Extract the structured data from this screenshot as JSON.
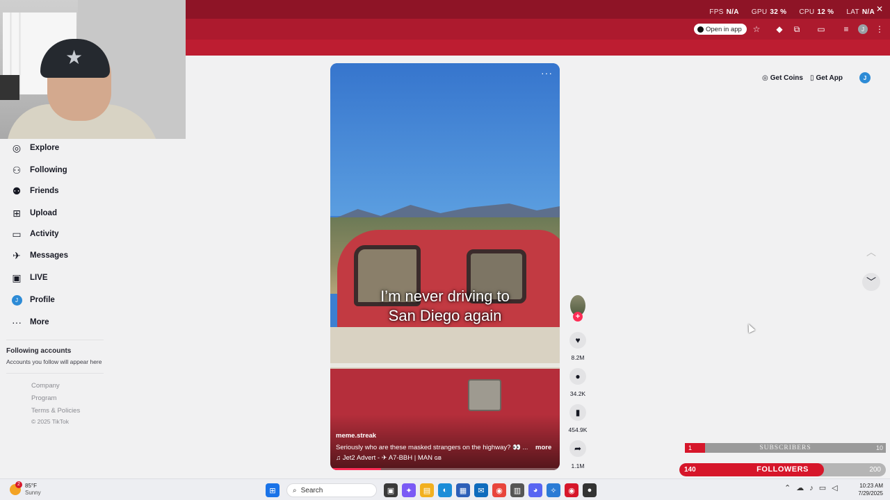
{
  "overlay": {
    "stats": [
      {
        "label": "FPS",
        "value": "N/A"
      },
      {
        "label": "GPU",
        "value": "32 %"
      },
      {
        "label": "CPU",
        "value": "12 %"
      },
      {
        "label": "LAT",
        "value": "N/A"
      }
    ],
    "close_glyph": "✕"
  },
  "browser": {
    "open_in_app": "Open in app",
    "profile_initial": "J",
    "toolbar_icons": [
      "star-icon",
      "extension-diamond-icon",
      "puzzle-icon",
      "cast-icon",
      "playlist-icon",
      "profile-icon",
      "kebab-menu-icon"
    ]
  },
  "sidebar": {
    "items": [
      {
        "label": "Explore",
        "icon": "compass-icon",
        "glyph": "◎"
      },
      {
        "label": "Following",
        "icon": "person-follow-icon",
        "glyph": "⚇"
      },
      {
        "label": "Friends",
        "icon": "friends-icon",
        "glyph": "⚉"
      },
      {
        "label": "Upload",
        "icon": "upload-plus-icon",
        "glyph": "⊞"
      },
      {
        "label": "Activity",
        "icon": "activity-message-icon",
        "glyph": "▭"
      },
      {
        "label": "Messages",
        "icon": "messages-icon",
        "glyph": "✈"
      },
      {
        "label": "LIVE",
        "icon": "live-tv-icon",
        "glyph": "▣"
      },
      {
        "label": "Profile",
        "icon": "profile-avatar-icon",
        "glyph": "J"
      },
      {
        "label": "More",
        "icon": "more-dots-icon",
        "glyph": "···"
      }
    ],
    "following_title": "Following accounts",
    "following_sub": "Accounts you follow will appear here",
    "footer_links": [
      "Company",
      "Program",
      "Terms & Policies"
    ],
    "copyright": "© 2025 TikTok"
  },
  "header_actions": {
    "get_coins": "Get Coins",
    "get_app": "Get App",
    "avatar_initial": "J"
  },
  "video": {
    "caption_line1": "I’m never driving to",
    "caption_line2": "San Diego again",
    "menu_glyph": "···",
    "author": "meme.streak",
    "description": "Seriously who are these masked strangers on the highway? 👀 ...",
    "more_label": "more",
    "music": "♫  Jet2 Advert - ✈ A7-BBH | MAN ɢʙ",
    "progress": 0.22
  },
  "actions": {
    "follow_plus": "+",
    "likes": "8.2M",
    "comments": "34.2K",
    "saves": "454.9K",
    "shares": "1.1M"
  },
  "stream_widgets": {
    "subscribers_count": "1",
    "subscribers_label": "SUBSCRIBERS",
    "subscribers_goal": "10",
    "subscribers_progress": 0.1,
    "followers_count": "140",
    "followers_label": "FOLLOWERS",
    "followers_goal": "200",
    "followers_progress": 0.7
  },
  "taskbar": {
    "weather_badge": "2",
    "temperature": "85°F",
    "condition": "Sunny",
    "search_label": "Search",
    "time": "10:23 AM",
    "date": "7/29/2025",
    "colors": {
      "windows": "#1a73e8",
      "red_accent": "#d6162a",
      "tiktok_pink": "#fe2c55"
    }
  }
}
